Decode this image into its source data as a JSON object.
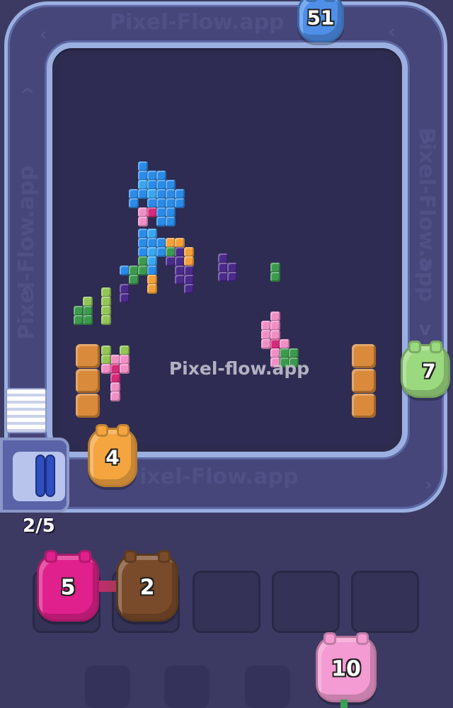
{
  "watermark": "Pixel-flow.app",
  "belt_text": "Pixel-Flow.app",
  "progress": {
    "label": "2/5",
    "current": 2,
    "total": 5
  },
  "pigs": {
    "belt_top": {
      "count": "51",
      "color": "#4f8fe8"
    },
    "belt_right": {
      "count": "7",
      "color": "#9bd97f"
    },
    "belt_bottom": {
      "count": "4",
      "color": "#f4a540"
    },
    "slot_1": {
      "count": "5",
      "color": "#e0208c"
    },
    "slot_2": {
      "count": "2",
      "color": "#7a4b2a"
    },
    "queue_next": {
      "count": "10",
      "color": "#f39bd2"
    }
  },
  "slots": {
    "total": 5,
    "filled": 2
  },
  "colors": {
    "blue": "#2b8be8",
    "cyan": "#3aa6f0",
    "orange": "#f2a03a",
    "purple": "#4a2a8a",
    "green": "#3c9a4e",
    "lime": "#93c556",
    "pink": "#f08fc6",
    "magenta": "#d62b7a",
    "wood": "#d98a3a"
  }
}
